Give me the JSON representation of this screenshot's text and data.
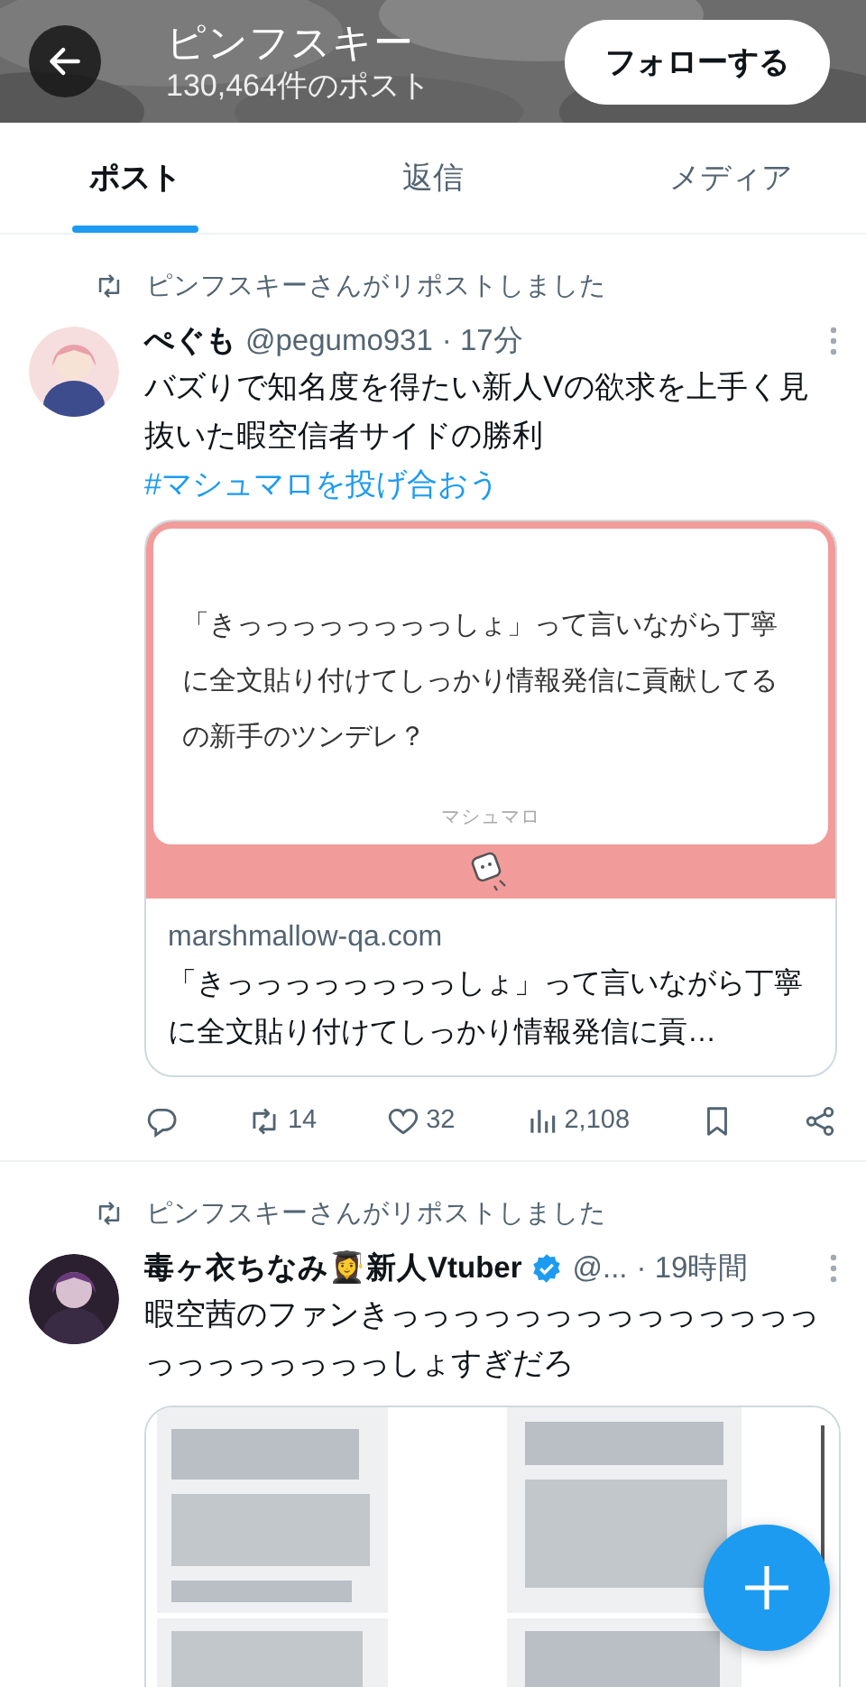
{
  "header": {
    "title": "ピンフスキー",
    "post_count": "130,464件のポスト",
    "follow_button": "フォローする"
  },
  "tabs": [
    {
      "label": "ポスト",
      "selected": true
    },
    {
      "label": "返信",
      "selected": false
    },
    {
      "label": "メディア",
      "selected": false
    }
  ],
  "posts": [
    {
      "repost_note": "ピンフスキーさんがリポストしました",
      "author": "ぺぐも",
      "verified": false,
      "handle": "@pegumo931",
      "time": "· 17分",
      "text": "バズりで知名度を得たい新人Vの欲求を上手く見抜いた暇空信者サイドの勝利",
      "hashtag": "#マシュマロを投げ合おう",
      "card": {
        "quote": "「きっっっっっっっっしょ」って言いながら丁寧に全文貼り付けてしっかり情報発信に貢献してるの新手のツンデレ？",
        "brand": "マシュマロ",
        "domain": "marshmallow-qa.com",
        "title": "「きっっっっっっっっしょ」って言いながら丁寧に全文貼り付けてしっかり情報発信に貢…"
      },
      "actions": [
        {
          "kind": "reply"
        },
        {
          "kind": "repost",
          "count": "14"
        },
        {
          "kind": "like",
          "count": "32"
        },
        {
          "kind": "views",
          "count": "2,108"
        },
        {
          "kind": "bookmark"
        },
        {
          "kind": "share"
        }
      ]
    },
    {
      "repost_note": "ピンフスキーさんがリポストしました",
      "author": "毒ヶ衣ちなみ👩‍🎓新人Vtuber",
      "verified": true,
      "handle": "@...",
      "time": "· 19時間",
      "text": "暇空茜のファンきっっっっっっっっっっっっっっっっっっっっっっしょすぎだろ"
    }
  ]
}
